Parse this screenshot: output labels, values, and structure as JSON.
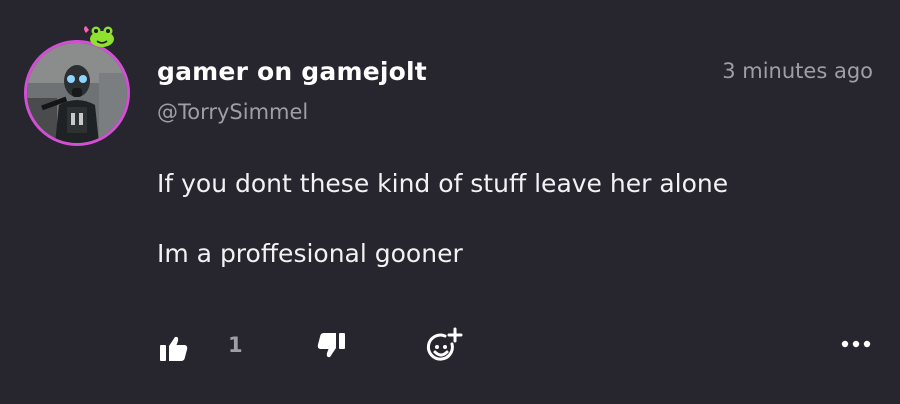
{
  "comment": {
    "author": {
      "display_name": "gamer on gamejolt",
      "username": "@TorrySimmel",
      "avatar_ring_color": "#d34fd4",
      "badge_icon": "frog-icon"
    },
    "timestamp": "3 minutes ago",
    "body_lines": [
      "If you dont these kind of stuff leave her alone",
      "Im a proffesional gooner"
    ]
  },
  "actions": {
    "like_icon": "thumbs-up-icon",
    "like_count": "1",
    "dislike_icon": "thumbs-down-icon",
    "react_icon": "add-reaction-icon",
    "more_icon": "more-options-icon"
  },
  "colors": {
    "background": "#27262f",
    "text_primary": "#ffffff",
    "text_muted": "#9f9ea6"
  }
}
